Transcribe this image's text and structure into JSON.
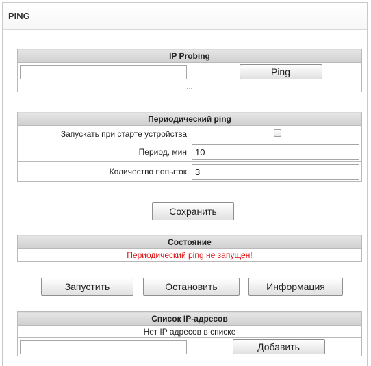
{
  "page": {
    "title": "PING"
  },
  "probing": {
    "header": "IP Probing",
    "input_value": "",
    "ping_button": "Ping",
    "result_text": "..."
  },
  "periodic": {
    "header": "Периодический ping",
    "start_on_boot_label": "Запускать при старте устройства",
    "start_on_boot_checked": false,
    "period_label": "Период, мин",
    "period_value": "10",
    "attempts_label": "Количество попыток",
    "attempts_value": "3"
  },
  "save_button": "Сохранить",
  "status": {
    "header": "Состояние",
    "text": "Периодический ping не запущен!",
    "text_color": "#e01010"
  },
  "actions": {
    "start": "Запустить",
    "stop": "Остановить",
    "info": "Информация"
  },
  "ip_list": {
    "header": "Список IP-адресов",
    "empty_text": "Нет IP адресов в списке",
    "input_value": "",
    "add_button": "Добавить"
  }
}
